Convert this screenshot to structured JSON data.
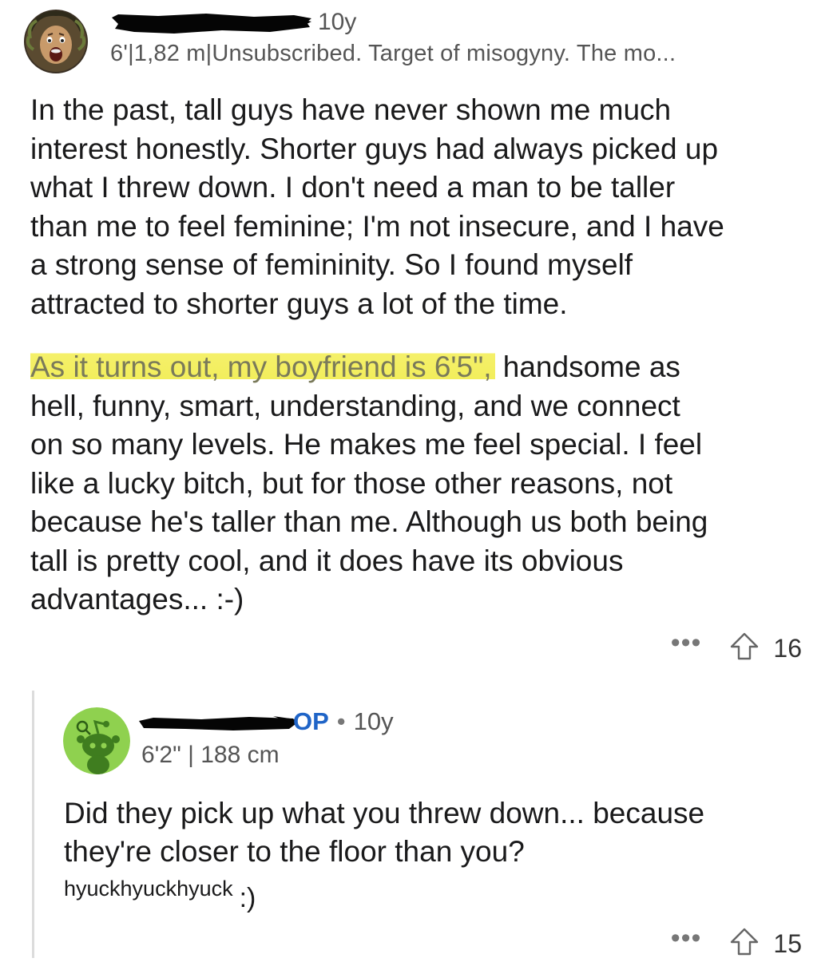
{
  "comment": {
    "age": "10y",
    "flair": "6'|1,82 m|Unsubscribed. Target of misogyny. The mo...",
    "paragraph1": [
      "In the past, tall guys have never shown me much",
      "interest honestly. Shorter guys had always picked up",
      "what I threw down. I don't need a man to be taller",
      "than me to feel feminine; I'm not insecure, and I have",
      "a strong sense of femininity. So I found myself",
      "attracted to shorter guys a lot of the time."
    ],
    "paragraph2_highlight": "As it turns out, my boyfriend is 6'5\",",
    "paragraph2_line1_rest": " handsome as",
    "paragraph2": [
      "hell, funny, smart, understanding, and we connect",
      "on so many levels. He makes me feel special. I feel",
      "like a lucky bitch, but for those other reasons, not",
      "because he's taller than me. Although us both being",
      "tall is pretty cool, and it does have its obvious",
      "advantages... :-)"
    ],
    "more_label": "•••",
    "upvotes": "16",
    "highlight_color": "#f2ee5c"
  },
  "reply": {
    "op_tag": "OP",
    "separator": "•",
    "age": "10y",
    "flair": "6'2\" | 188 cm",
    "body": [
      "Did they pick up what you threw down... because",
      "they're closer to the floor than you?"
    ],
    "small_text": "hyuckhyuckhyuck",
    "emoticon": ":)",
    "more_label": "•••",
    "upvotes": "15",
    "op_color": "#1f64c7",
    "avatar_color": "#8fd14f"
  }
}
